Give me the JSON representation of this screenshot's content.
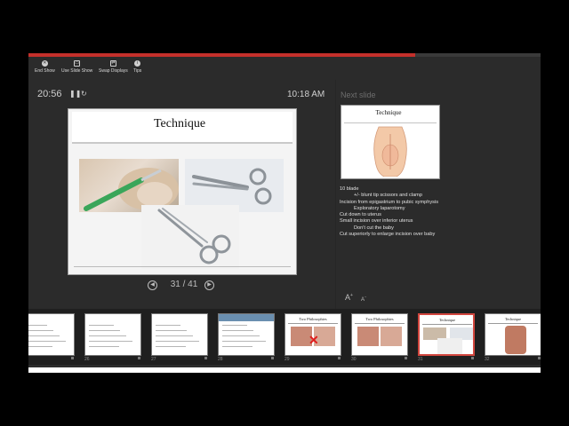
{
  "toolbar": {
    "end_show": "End Show",
    "use_slide_show": "Use Slide Show",
    "swap_displays": "Swap Displays",
    "tips": "Tips"
  },
  "presenter": {
    "elapsed": "20:56",
    "clock": "10:18 AM",
    "slide_progress": 0.756
  },
  "current_slide": {
    "title": "Technique",
    "counter": "31 / 41"
  },
  "next_slide": {
    "label": "Next slide",
    "title": "Technique"
  },
  "notes": [
    {
      "text": "10 blade",
      "indent": 0
    },
    {
      "text": "+/- blunt tip scissors and clamp",
      "indent": 1
    },
    {
      "text": "Incision from epigastrium to pubic symphysis",
      "indent": 0
    },
    {
      "text": "Exploratory laparotomy",
      "indent": 1
    },
    {
      "text": "Cut down to uterus",
      "indent": 0
    },
    {
      "text": "Small incision over inferior uterus",
      "indent": 0
    },
    {
      "text": "Don't cut the baby",
      "indent": 1
    },
    {
      "text": "Cut superiorly to enlarge incision over baby",
      "indent": 0
    }
  ],
  "font_controls": {
    "increase": "A",
    "decrease": "A"
  },
  "thumbnails": [
    {
      "num": "",
      "title": "",
      "kind": "text"
    },
    {
      "num": "26",
      "title": "",
      "kind": "text"
    },
    {
      "num": "27",
      "title": "",
      "kind": "text"
    },
    {
      "num": "28",
      "title": "",
      "kind": "bar"
    },
    {
      "num": "29",
      "title": "Two Philosophies",
      "kind": "photos-x"
    },
    {
      "num": "30",
      "title": "Two Philosophies",
      "kind": "photos"
    },
    {
      "num": "31",
      "title": "Technique",
      "kind": "tools",
      "active": true
    },
    {
      "num": "32",
      "title": "Technique",
      "kind": "anatomy"
    }
  ],
  "colors": {
    "accent": "#c4302b",
    "panel": "#2b2b2b",
    "strip": "#1f1f1f"
  }
}
